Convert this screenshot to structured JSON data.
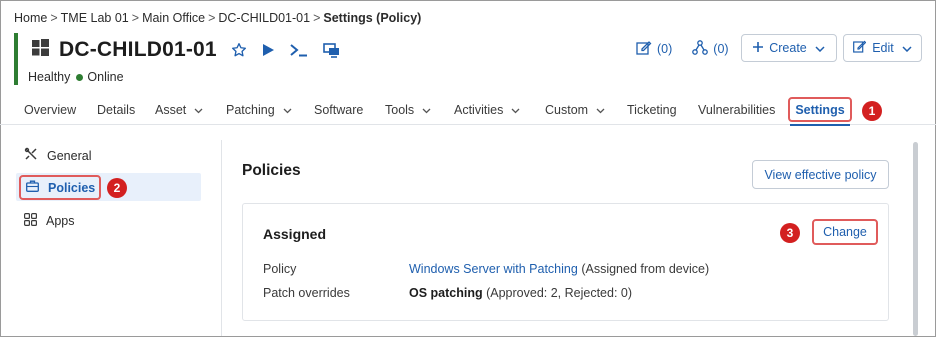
{
  "breadcrumb": {
    "items": [
      "Home",
      "TME Lab 01",
      "Main Office",
      "DC-CHILD01-01"
    ],
    "separator": ">",
    "current": "Settings (Policy)"
  },
  "device": {
    "name": "DC-CHILD01-01",
    "health": "Healthy",
    "status": "Online",
    "status_color": "#2e7d32"
  },
  "header_counters": [
    {
      "icon": "edit-note-icon",
      "value": "(0)"
    },
    {
      "icon": "share-nodes-icon",
      "value": "(0)"
    }
  ],
  "header_buttons": {
    "create_label": "Create",
    "edit_label": "Edit"
  },
  "tabs": [
    {
      "label": "Overview",
      "dropdown": false
    },
    {
      "label": "Details",
      "dropdown": false
    },
    {
      "label": "Asset",
      "dropdown": true
    },
    {
      "label": "Patching",
      "dropdown": true
    },
    {
      "label": "Software",
      "dropdown": false
    },
    {
      "label": "Tools",
      "dropdown": true
    },
    {
      "label": "Activities",
      "dropdown": true
    },
    {
      "label": "Custom",
      "dropdown": true
    },
    {
      "label": "Ticketing",
      "dropdown": false
    },
    {
      "label": "Vulnerabilities",
      "dropdown": false
    },
    {
      "label": "Settings",
      "dropdown": false,
      "active": true
    }
  ],
  "sidebar": {
    "items": [
      {
        "label": "General",
        "icon": "tools-icon"
      },
      {
        "label": "Policies",
        "icon": "briefcase-icon",
        "selected": true
      },
      {
        "label": "Apps",
        "icon": "apps-grid-icon"
      }
    ]
  },
  "main": {
    "title": "Policies",
    "view_effective_label": "View effective policy",
    "card": {
      "title": "Assigned",
      "change_label": "Change",
      "rows": [
        {
          "label": "Policy",
          "value_link": "Windows Server with Patching",
          "value_note": "(Assigned from device)"
        },
        {
          "label": "Patch overrides",
          "value_strong": "OS patching",
          "value_note": "(Approved: 2, Rejected: 0)"
        }
      ]
    }
  },
  "callouts": [
    "1",
    "2",
    "3"
  ],
  "colors": {
    "accent": "#1f5fae",
    "callout": "#d32020",
    "highlight_border": "#e05b5b",
    "selected_bg": "#e8f0fb"
  }
}
